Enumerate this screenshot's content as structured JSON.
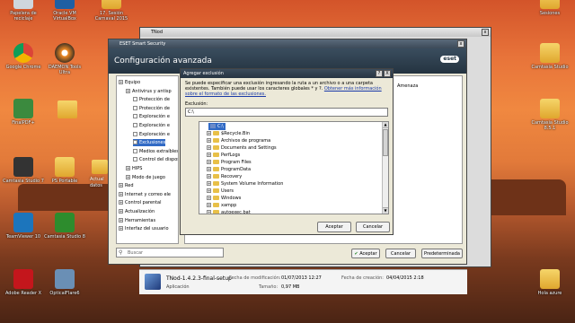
{
  "desktop": {
    "left_icons": [
      {
        "label": "Papelera de\nreciclaje"
      },
      {
        "label": "Google Chrome"
      },
      {
        "label": "FinalPDF+"
      },
      {
        "label": "Camtasia Studio 7"
      },
      {
        "label": "TeamViewer 10"
      },
      {
        "label": "Adobe Reader X"
      }
    ],
    "left_icons_col2": [
      {
        "label": "Oracle VM\nVirtualBox"
      },
      {
        "label": "DAEMON Tools\nUltra"
      },
      {
        "label": "PS Portable"
      },
      {
        "label": "Camtasia Studio 8"
      },
      {
        "label": "OpticalFlare6"
      }
    ],
    "top_icons": [
      {
        "label": "17. Sesión\nCarnaval 2015"
      }
    ],
    "right_icons": [
      {
        "label": "Sesiones"
      },
      {
        "label": "Camtasia Studio"
      },
      {
        "label": "Camtasia Studio\n8.5.1"
      },
      {
        "label": "Hola azure"
      }
    ],
    "partial_labels": [
      "Actual",
      "datos"
    ]
  },
  "tnod_window": {
    "title": "TNod"
  },
  "eset_window": {
    "title": "ESET Smart Security",
    "header": "Configuración avanzada",
    "logo": "eset",
    "tree": [
      {
        "label": "Equipo",
        "level": 0
      },
      {
        "label": "Antivirus y antisp",
        "level": 1
      },
      {
        "label": "Protección de",
        "level": 2
      },
      {
        "label": "Protección de",
        "level": 2
      },
      {
        "label": "Exploración e",
        "level": 2
      },
      {
        "label": "Exploración e",
        "level": 2
      },
      {
        "label": "Exploración e",
        "level": 2
      },
      {
        "label": "Exclusiones",
        "level": 2,
        "selected": true
      },
      {
        "label": "Medios extraíbles",
        "level": 2
      },
      {
        "label": "Control del dispos",
        "level": 2
      },
      {
        "label": "HIPS",
        "level": 1
      },
      {
        "label": "Modo de juego",
        "level": 1
      },
      {
        "label": "Red",
        "level": 0
      },
      {
        "label": "Internet y correo ele",
        "level": 0
      },
      {
        "label": "Control parental",
        "level": 0
      },
      {
        "label": "Actualización",
        "level": 0
      },
      {
        "label": "Herramientas",
        "level": 0
      },
      {
        "label": "Interfaz del usuario",
        "level": 0
      }
    ],
    "column_header": "Amenaza",
    "search_placeholder": "Buscar",
    "buttons": {
      "accept": "Aceptar",
      "cancel": "Cancelar",
      "default": "Predeterminada"
    }
  },
  "dialog": {
    "title": "Agregar exclusión",
    "help": "?",
    "close": "X",
    "description": "Se puede especificar una exclusión ingresando la ruta a un archivo o a una carpeta existentes. También puede usar los caracteres globales * y ?.",
    "link": "Obtener más información sobre el formato de las exclusiones.",
    "field_label": "Exclusión:",
    "field_value": "C:\\",
    "root": "C:\\",
    "items": [
      "$Recycle.Bin",
      "Archivos de programa",
      "Documents and Settings",
      "PerfLogs",
      "Program Files",
      "ProgramData",
      "Recovery",
      "System Volume Information",
      "Users",
      "Windows",
      "xampp",
      "autoexec.bat"
    ],
    "accept": "Aceptar",
    "cancel": "Cancelar"
  },
  "file_info": {
    "name": "TNod-1.4.2.3-final-setup",
    "type": "Aplicación",
    "modified_label": "Fecha de modificación:",
    "modified_value": "01/07/2013 12:27",
    "created_label": "Fecha de creación:",
    "created_value": "04/04/2015 2:18",
    "size_label": "Tamaño:",
    "size_value": "0,97 MB"
  }
}
